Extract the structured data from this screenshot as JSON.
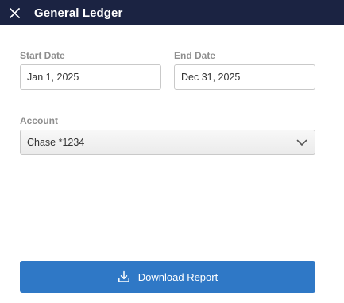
{
  "window": {
    "title": "General Ledger",
    "close_icon": "close-icon"
  },
  "form": {
    "start_date": {
      "label": "Start Date",
      "value": "Jan 1, 2025"
    },
    "end_date": {
      "label": "End Date",
      "value": "Dec 31, 2025"
    },
    "account": {
      "label": "Account",
      "selected": "Chase *1234",
      "icon": "chevron-down-icon"
    }
  },
  "actions": {
    "download_label": "Download Report",
    "download_icon": "download-icon"
  },
  "colors": {
    "titlebar": "#1b2342",
    "primary_button": "#2f78c6",
    "label": "#8e8e8e"
  }
}
